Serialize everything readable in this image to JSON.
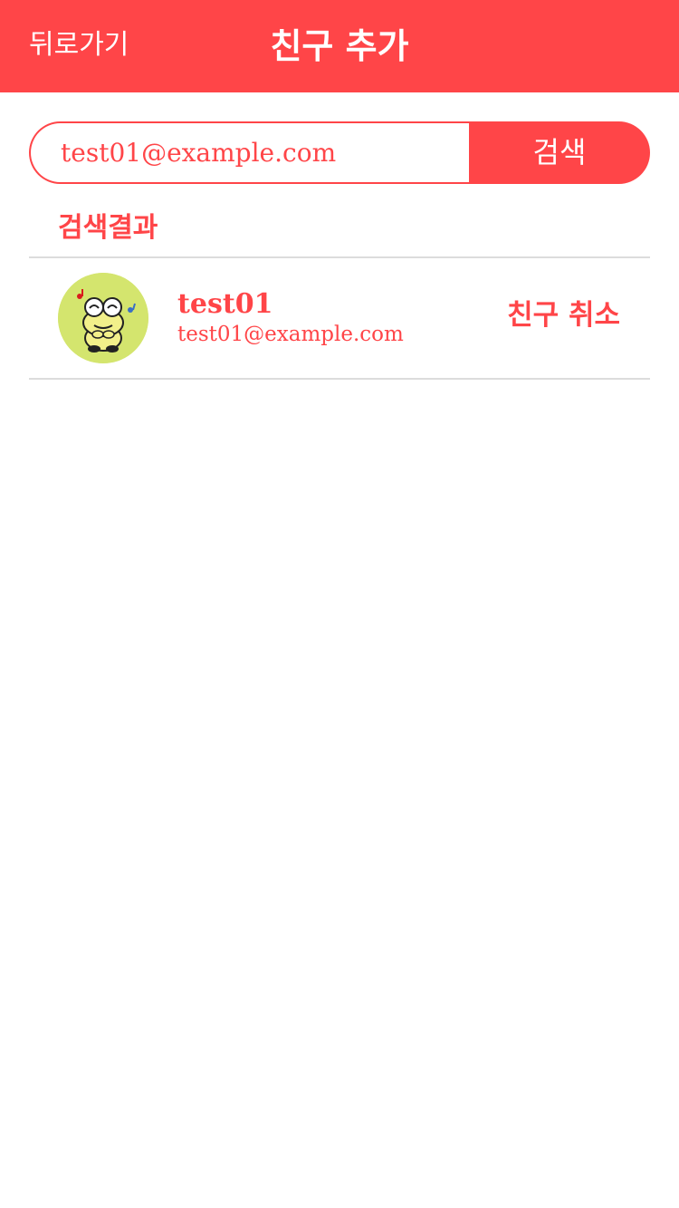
{
  "header": {
    "back_label": "뒤로가기",
    "title": "친구 추가"
  },
  "search": {
    "value": "test01@example.com",
    "button_label": "검색"
  },
  "results": {
    "section_title": "검색결과",
    "items": [
      {
        "name": "test01",
        "email": "test01@example.com",
        "action_label": "친구 취소",
        "avatar_icon": "frog-avatar-icon"
      }
    ]
  },
  "colors": {
    "accent": "#ff4548",
    "avatar_bg": "#d4e56e",
    "divider": "#dcdcdc"
  }
}
